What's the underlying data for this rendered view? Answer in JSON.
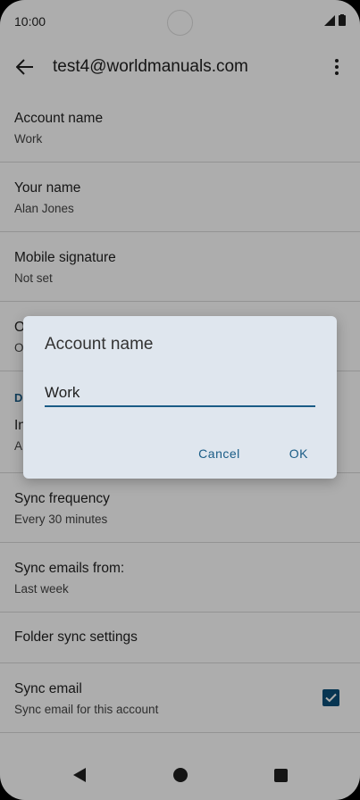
{
  "status_bar": {
    "time": "10:00"
  },
  "app_bar": {
    "title": "test4@worldmanuals.com"
  },
  "settings": {
    "account_name": {
      "label": "Account name",
      "value": "Work"
    },
    "your_name": {
      "label": "Your name",
      "value": "Alan Jones"
    },
    "mobile_signature": {
      "label": "Mobile signature",
      "value": "Not set"
    },
    "partial_1": {
      "label": "O",
      "value": "O"
    },
    "section_header_partial": "D",
    "partial_2": {
      "label": "In",
      "value": "A"
    },
    "sync_frequency": {
      "label": "Sync frequency",
      "value": "Every 30 minutes"
    },
    "sync_emails_from": {
      "label": "Sync emails from:",
      "value": "Last week"
    },
    "folder_sync": {
      "label": "Folder sync settings"
    },
    "sync_email": {
      "label": "Sync email",
      "value": "Sync email for this account",
      "checked": true
    }
  },
  "dialog": {
    "title": "Account name",
    "input_value": "Work",
    "cancel_label": "Cancel",
    "ok_label": "OK"
  },
  "colors": {
    "accent": "#1a5c86",
    "checkbox": "#0b4f79",
    "dialog_bg": "#dfe6ee"
  }
}
